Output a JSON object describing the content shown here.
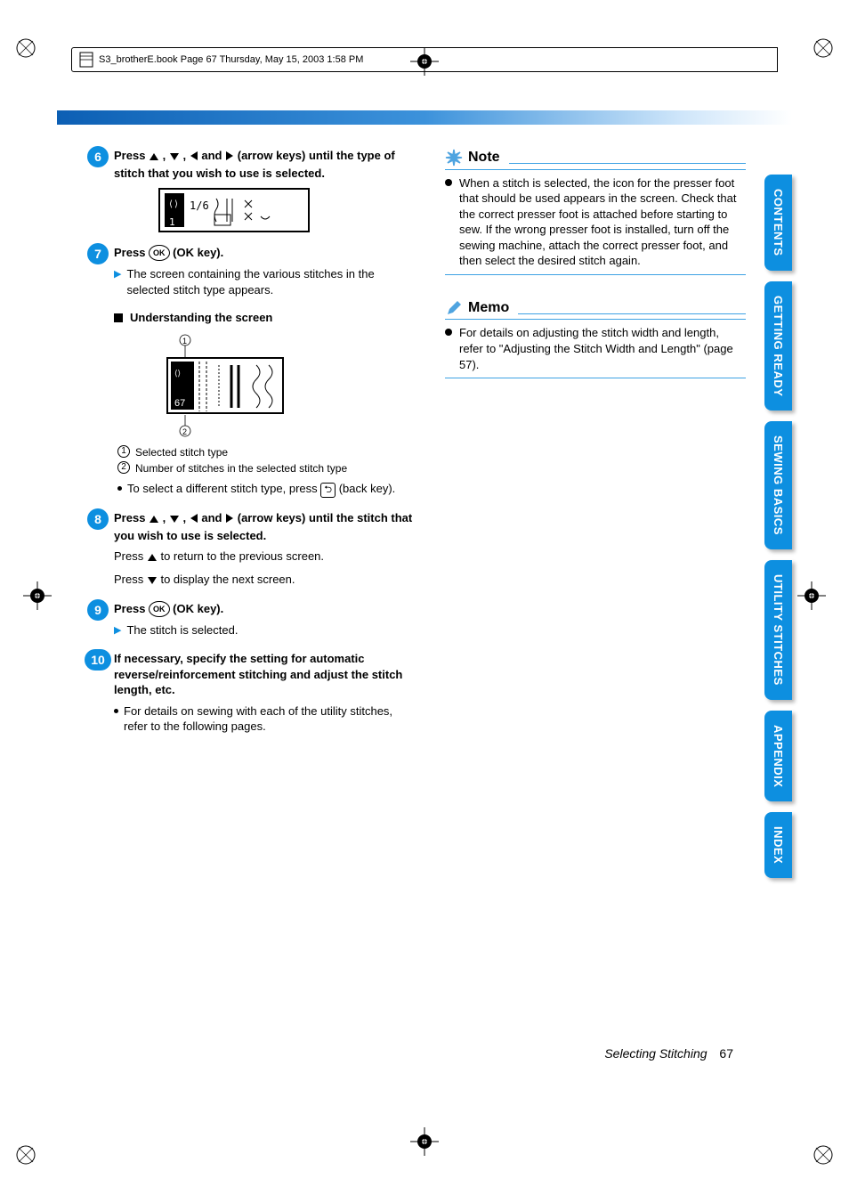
{
  "header": {
    "filepath": "S3_brotherE.book  Page 67  Thursday, May 15, 2003  1:58 PM"
  },
  "tabs": [
    {
      "label": "CONTENTS"
    },
    {
      "label": "GETTING READY"
    },
    {
      "label": "SEWING BASICS"
    },
    {
      "label": "UTILITY STITCHES"
    },
    {
      "label": "APPENDIX"
    },
    {
      "label": "INDEX"
    }
  ],
  "steps": {
    "s6": {
      "num": "6",
      "pre": "Press ",
      "mid1": " , ",
      "mid2": " , ",
      "mid3": " and ",
      "post": " (arrow keys) until the type of stitch that you wish to use is selected.",
      "screen_hint": "1/6"
    },
    "s7": {
      "num": "7",
      "pre": "Press ",
      "post": " (OK key).",
      "result": "The screen containing the various stitches in the selected stitch type appears."
    },
    "subhead": "Understanding the screen",
    "legend1": "Selected stitch type",
    "legend2": "Number of stitches in the selected stitch type",
    "backkey_line_pre": "To select a different stitch type, press ",
    "backkey_line_post": " (back key).",
    "s8": {
      "num": "8",
      "pre": "Press ",
      "mid1": " , ",
      "mid2": " , ",
      "mid3": " and ",
      "post": " (arrow keys) until the stitch that you wish to use is selected.",
      "sub1_pre": "Press ",
      "sub1_post": " to return to the previous screen.",
      "sub2_pre": "Press ",
      "sub2_post": " to display the next screen."
    },
    "s9": {
      "num": "9",
      "pre": "Press ",
      "post": " (OK key).",
      "result": "The stitch is selected."
    },
    "s10": {
      "num": "10",
      "text": "If necessary, specify the setting for automatic reverse/reinforcement stitching and adjust the stitch length, etc.",
      "bullet": "For details on sewing with each of the utility stitches, refer to the following pages."
    }
  },
  "note": {
    "title": "Note",
    "body": "When a stitch is selected, the icon for the presser foot that should be used appears in the screen. Check that the correct presser foot is attached before starting to sew. If the wrong presser foot is installed, turn off the sewing machine, attach the correct presser foot, and then select the desired stitch again."
  },
  "memo": {
    "title": "Memo",
    "body": "For details on adjusting the stitch width and length, refer to \"Adjusting the Stitch Width and Length\" (page 57)."
  },
  "footer": {
    "title": "Selecting Stitching",
    "page": "67"
  },
  "ok_label": "OK",
  "back_symbol": "⮌"
}
